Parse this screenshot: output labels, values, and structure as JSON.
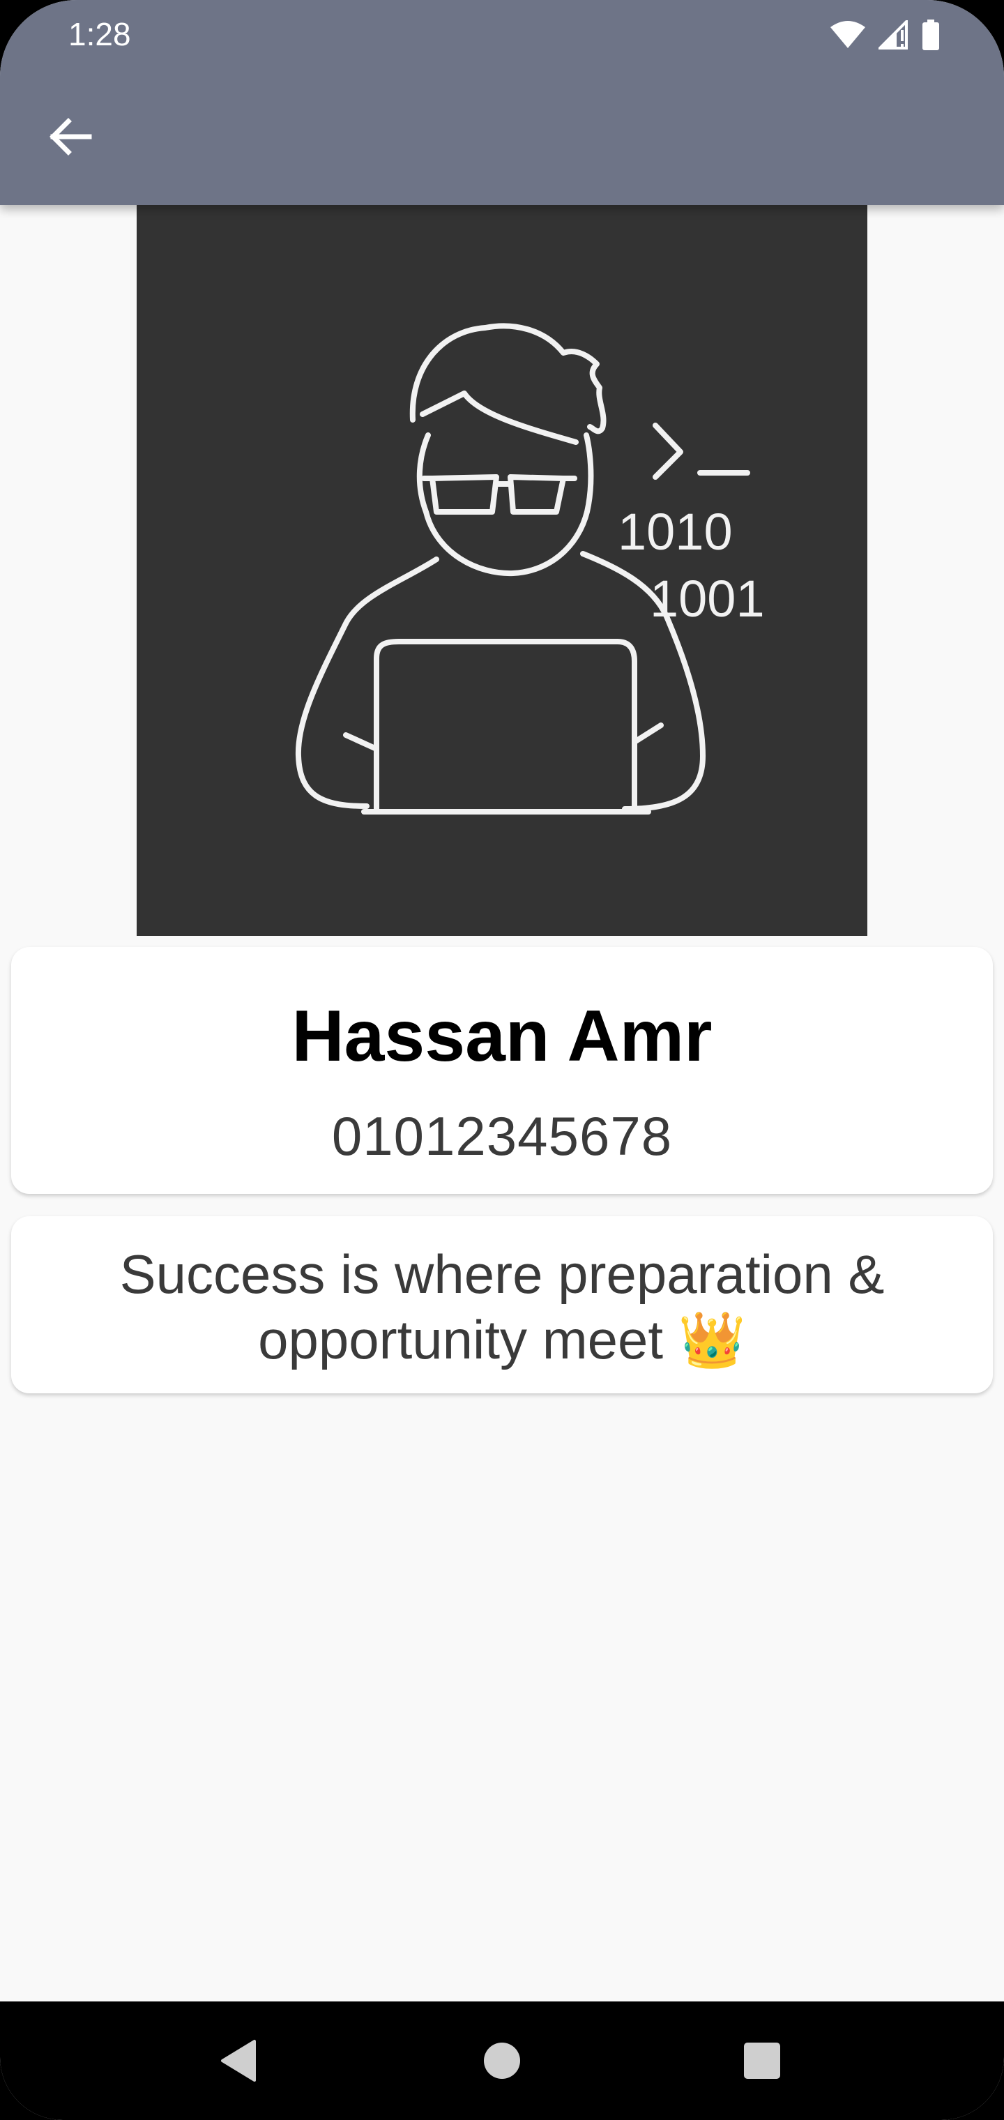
{
  "status_bar": {
    "time": "1:28",
    "icons": [
      "wifi-icon",
      "cell-signal-icon",
      "battery-icon"
    ]
  },
  "app_bar": {
    "back_icon": "arrow-left-icon",
    "background_color": "#6e7487"
  },
  "profile": {
    "image_icon": "programmer-with-laptop-illustration",
    "image_text_line1": "1010",
    "image_text_line2": "1001",
    "image_prompt": ">_",
    "name": "Hassan Amr",
    "phone": "01012345678",
    "quote": "Success is where preparation & opportunity meet 👑"
  },
  "nav_bar": {
    "icons": [
      "back-triangle-icon",
      "home-circle-icon",
      "recents-square-icon"
    ]
  }
}
